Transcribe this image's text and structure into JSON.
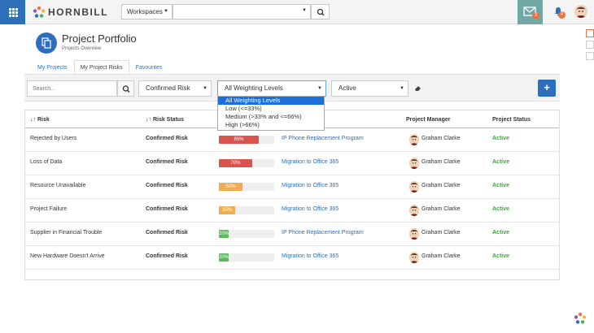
{
  "header": {
    "brand": "HORNBILL",
    "workspace_label": "Workspaces",
    "mail_badge": "3",
    "notif_badge": "4"
  },
  "page": {
    "title": "Project Portfolio",
    "subtitle": "Projects Overview"
  },
  "tabs": [
    {
      "label": "My Projects",
      "active": false
    },
    {
      "label": "My Project Risks",
      "active": true
    },
    {
      "label": "Favourites",
      "active": false
    }
  ],
  "filters": {
    "search_placeholder": "Search...",
    "risk_status": "Confirmed Risk",
    "weighting": "All Weighting Levels",
    "project_status": "Active",
    "add_label": "+",
    "weighting_options": [
      "All Weighting Levels",
      "Low (<=33%)",
      "Medium (>33% and <=66%)",
      "High (>66%)"
    ]
  },
  "table": {
    "headers": {
      "risk": "Risk",
      "risk_status": "Risk Status",
      "project_manager": "Project Manager",
      "project_status": "Project Status"
    },
    "rows": [
      {
        "risk": "Rejected by Users",
        "status": "Confirmed Risk",
        "weight": 85,
        "weight_label": "85%",
        "project": "IP Phone Replacement Program",
        "manager": "Graham Clarke",
        "project_status": "Active"
      },
      {
        "risk": "Loss of Data",
        "status": "Confirmed Risk",
        "weight": 70,
        "weight_label": "70%",
        "project": "Migration to Office 365",
        "manager": "Graham Clarke",
        "project_status": "Active"
      },
      {
        "risk": "Resource Unavailable",
        "status": "Confirmed Risk",
        "weight": 50,
        "weight_label": "50%",
        "project": "Migration to Office 365",
        "manager": "Graham Clarke",
        "project_status": "Active"
      },
      {
        "risk": "Project Failure",
        "status": "Confirmed Risk",
        "weight": 35,
        "weight_label": "35%",
        "project": "Migration to Office 365",
        "manager": "Graham Clarke",
        "project_status": "Active"
      },
      {
        "risk": "Supplier in Financial Trouble",
        "status": "Confirmed Risk",
        "weight": 20,
        "weight_label": "20%",
        "project": "IP Phone Replacement Program",
        "manager": "Graham Clarke",
        "project_status": "Active"
      },
      {
        "risk": "New Hardware Doesn't Arrive",
        "status": "Confirmed Risk",
        "weight": 20,
        "weight_label": "20%",
        "project": "Migration to Office 365",
        "manager": "Graham Clarke",
        "project_status": "Active"
      }
    ]
  },
  "colors": {
    "primary": "#2d6fb8",
    "high": "#d9534f",
    "medium": "#f0ad4e",
    "low": "#5cb85c",
    "active_text": "#3aa93a",
    "selected_option": "#1e6fd9"
  },
  "icons": {
    "apps": "grid-icon",
    "search": "search-icon",
    "mail": "mail-icon",
    "bell": "bell-icon",
    "eraser": "eraser-icon",
    "sort": "sort-icon"
  }
}
